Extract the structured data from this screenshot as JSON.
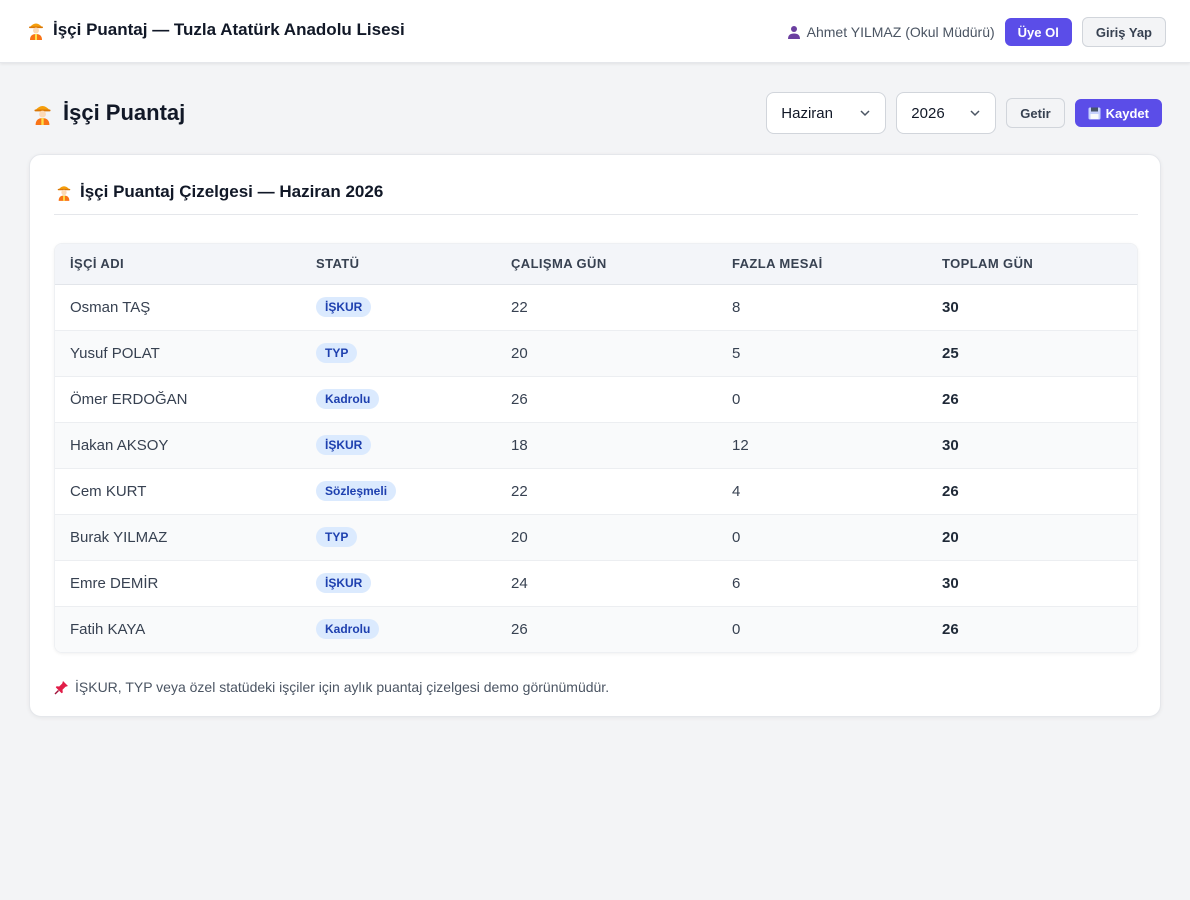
{
  "header": {
    "app_title": "İşçi Puantaj — Tuzla Atatürk Anadolu Lisesi",
    "user_name": "Ahmet YILMAZ (Okul Müdürü)",
    "register_label": "Üye Ol",
    "login_label": "Giriş Yap"
  },
  "page": {
    "title": "İşçi Puantaj",
    "month_select": {
      "value": "Haziran"
    },
    "year_select": {
      "value": "2026"
    },
    "fetch_label": "Getir",
    "save_label": "Kaydet"
  },
  "card": {
    "title": "İşçi Puantaj Çizelgesi — Haziran 2026",
    "columns": [
      "İŞÇİ ADI",
      "STATÜ",
      "ÇALIŞMA GÜN",
      "FAZLA MESAİ",
      "TOPLAM GÜN"
    ],
    "rows": [
      {
        "name": "Osman TAŞ",
        "status": "İŞKUR",
        "work_days": "22",
        "overtime": "8",
        "total": "30"
      },
      {
        "name": "Yusuf POLAT",
        "status": "TYP",
        "work_days": "20",
        "overtime": "5",
        "total": "25"
      },
      {
        "name": "Ömer ERDOĞAN",
        "status": "Kadrolu",
        "work_days": "26",
        "overtime": "0",
        "total": "26"
      },
      {
        "name": "Hakan AKSOY",
        "status": "İŞKUR",
        "work_days": "18",
        "overtime": "12",
        "total": "30"
      },
      {
        "name": "Cem KURT",
        "status": "Sözleşmeli",
        "work_days": "22",
        "overtime": "4",
        "total": "26"
      },
      {
        "name": "Burak YILMAZ",
        "status": "TYP",
        "work_days": "20",
        "overtime": "0",
        "total": "20"
      },
      {
        "name": "Emre DEMİR",
        "status": "İŞKUR",
        "work_days": "24",
        "overtime": "6",
        "total": "30"
      },
      {
        "name": "Fatih KAYA",
        "status": "Kadrolu",
        "work_days": "26",
        "overtime": "0",
        "total": "26"
      }
    ],
    "footnote": "İŞKUR, TYP veya özel statüdeki işçiler için aylık puantaj çizelgesi demo görünümüdür."
  },
  "colors": {
    "accent": "#5b4de8",
    "badge_bg": "#dbeafe",
    "badge_text": "#1e40af"
  },
  "icons": {
    "brand": "construction-worker-icon",
    "user": "user-icon",
    "save": "floppy-disk-icon",
    "footnote": "pushpin-icon",
    "select": "chevron-down-icon"
  }
}
